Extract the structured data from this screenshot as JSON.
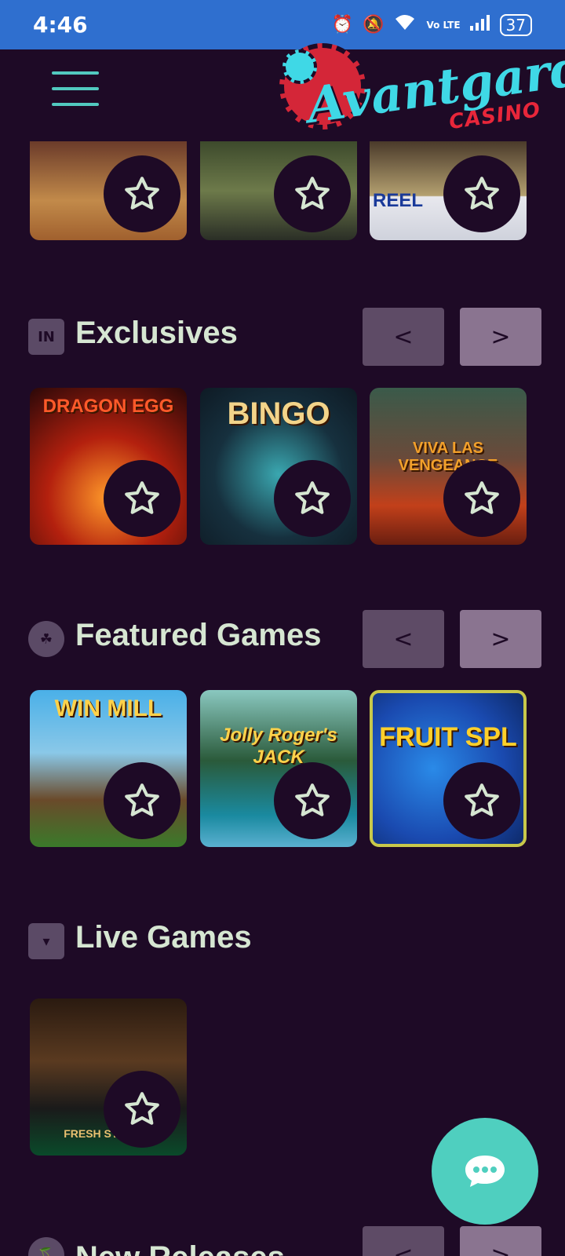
{
  "status_bar": {
    "time": "4:46",
    "battery": "37",
    "network": "Vo LTE"
  },
  "header": {
    "logo_name": "Avantgarde",
    "logo_sub": "CASINO"
  },
  "sections": {
    "exclusives": {
      "title": "Exclusives",
      "icon_text": "IN",
      "prev": "<",
      "next": ">",
      "games": [
        "DRAGON EGG",
        "BINGO",
        "VIVA LAS VENGEANCE"
      ]
    },
    "featured": {
      "title": "Featured Games",
      "prev": "<",
      "next": ">",
      "games": [
        "WIN MILL",
        "Jolly Roger's JACK",
        "FRUIT SPL"
      ]
    },
    "live": {
      "title": "Live Games",
      "games": [
        "FRESH STUDIOS"
      ]
    },
    "new_releases": {
      "title": "New Releases",
      "prev": "<",
      "next": ">"
    }
  },
  "top_row": {
    "labels": [
      "",
      "",
      "REEL"
    ]
  },
  "colors": {
    "background": "#1e0a26",
    "accent": "#4fcfbf",
    "status_bar": "#2f6fcf"
  }
}
